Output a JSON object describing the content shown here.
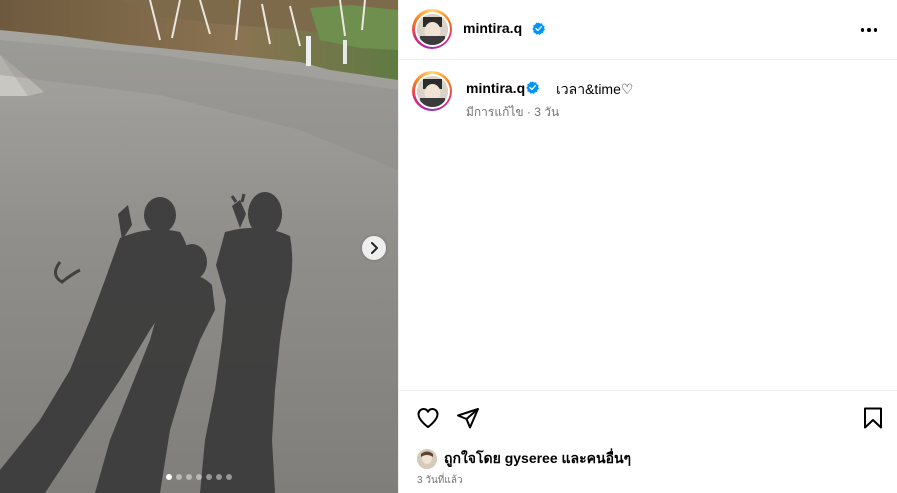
{
  "post": {
    "username": "mintira.q",
    "caption": "เวลา&time♡",
    "meta": "มีการแก้ไข · 3 วัน",
    "likes_text": "ถูกใจโดย gyseree และคนอื่นๆ",
    "timestamp": "3 วันที่แล้ว"
  },
  "carousel": {
    "current_slide": 1,
    "total_slides": 7
  },
  "icons": {
    "verified": "verified-badge-icon",
    "more": "more-options-icon",
    "like": "heart-icon",
    "share": "paper-plane-icon",
    "save": "bookmark-icon",
    "next": "chevron-right-icon"
  },
  "colors": {
    "verified": "#0095f6",
    "meta_text": "#737373",
    "border": "#efefef"
  }
}
